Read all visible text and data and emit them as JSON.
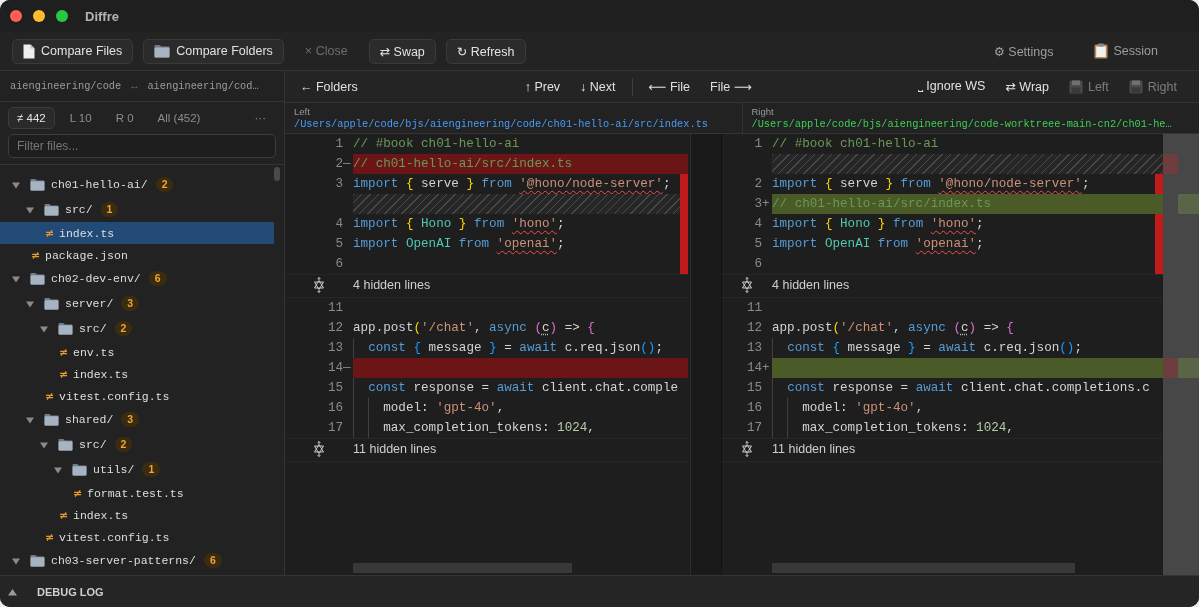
{
  "window": {
    "title": "Diffre"
  },
  "toolbar": {
    "start": [
      {
        "label": "Compare Files",
        "kind": "document",
        "disabled": false
      },
      {
        "label": "Compare Folders",
        "kind": "folder",
        "disabled": false
      },
      {
        "label": "× Close",
        "kind": "plain",
        "disabled": true
      },
      {
        "label": "⇄ Swap",
        "kind": "bordered",
        "disabled": false
      },
      {
        "label": "↻ Refresh",
        "kind": "bordered",
        "disabled": false
      }
    ],
    "end": [
      {
        "label": "⚙ Settings",
        "kind": "plain",
        "disabled": false
      },
      {
        "label": "Session",
        "kind": "clipboard",
        "disabled": false
      }
    ]
  },
  "sidebar": {
    "roots": {
      "left": "aiengineering/code",
      "separator": "↔",
      "right": "aiengineering/cod…"
    },
    "filters": [
      {
        "label": "≠ 442",
        "selected": true
      },
      {
        "label": "L 10",
        "selected": false
      },
      {
        "label": "R 0",
        "selected": false
      },
      {
        "label": "All (452)",
        "selected": false
      }
    ],
    "more": "···",
    "search": {
      "placeholder": "Filter files..."
    },
    "tree": [
      {
        "kind": "folder",
        "name": "ch01-hello-ai/",
        "count": "2",
        "expanded": true,
        "selected": false,
        "children": [
          {
            "kind": "folder",
            "name": "src/",
            "count": "1",
            "expanded": true,
            "selected": false,
            "children": [
              {
                "kind": "file",
                "marker": "≠",
                "name": "index.ts",
                "selected": true
              }
            ]
          },
          {
            "kind": "file",
            "marker": "≠",
            "name": "package.json",
            "selected": false
          }
        ]
      },
      {
        "kind": "folder",
        "name": "ch02-dev-env/",
        "count": "6",
        "expanded": true,
        "selected": false,
        "children": [
          {
            "kind": "folder",
            "name": "server/",
            "count": "3",
            "expanded": true,
            "selected": false,
            "children": [
              {
                "kind": "folder",
                "name": "src/",
                "count": "2",
                "expanded": true,
                "selected": false,
                "children": [
                  {
                    "kind": "file",
                    "marker": "≠",
                    "name": "env.ts",
                    "selected": false
                  },
                  {
                    "kind": "file",
                    "marker": "≠",
                    "name": "index.ts",
                    "selected": false
                  }
                ]
              },
              {
                "kind": "file",
                "marker": "≠",
                "name": "vitest.config.ts",
                "selected": false
              }
            ]
          },
          {
            "kind": "folder",
            "name": "shared/",
            "count": "3",
            "expanded": true,
            "selected": false,
            "children": [
              {
                "kind": "folder",
                "name": "src/",
                "count": "2",
                "expanded": true,
                "selected": false,
                "children": [
                  {
                    "kind": "folder",
                    "name": "utils/",
                    "count": "1",
                    "expanded": true,
                    "selected": false,
                    "children": [
                      {
                        "kind": "file",
                        "marker": "≠",
                        "name": "format.test.ts",
                        "selected": false
                      }
                    ]
                  },
                  {
                    "kind": "file",
                    "marker": "≠",
                    "name": "index.ts",
                    "selected": false
                  }
                ]
              },
              {
                "kind": "file",
                "marker": "≠",
                "name": "vitest.config.ts",
                "selected": false
              }
            ]
          }
        ]
      },
      {
        "kind": "folder",
        "name": "ch03-server-patterns/",
        "count": "6",
        "expanded": true,
        "selected": false
      }
    ]
  },
  "nav": {
    "start": [
      {
        "label": "← Folders",
        "kind": "text",
        "disabled": false
      }
    ],
    "groups": [
      [
        {
          "label": "↑ Prev",
          "kind": "text",
          "disabled": false
        },
        {
          "label": "↓ Next",
          "kind": "text",
          "disabled": false
        }
      ],
      [
        {
          "label": "⟵ File",
          "kind": "text",
          "disabled": false
        },
        {
          "label": "File ⟶",
          "kind": "text",
          "disabled": false
        }
      ]
    ],
    "end": [
      {
        "label": "⎵ Ignore WS",
        "kind": "text",
        "disabled": false
      },
      {
        "label": "⇄ Wrap",
        "kind": "text",
        "disabled": false
      },
      {
        "label": "Left",
        "kind": "disk",
        "disabled": true
      },
      {
        "label": "Right",
        "kind": "disk",
        "disabled": true
      }
    ]
  },
  "panes": [
    {
      "label": "Left",
      "path": "/Users/apple/code/bjs/aiengineering/code/ch01-hello-ai/src/index.ts",
      "color": "#4a9bf5",
      "rows": [
        {
          "kind": "context",
          "number": "1",
          "flagged": false,
          "tokens": [
            {
              "kind": "comment",
              "text": "// #book ch01-hello-ai"
            }
          ]
        },
        {
          "kind": "deleted",
          "number": "2",
          "sign": "—",
          "flagged": false,
          "tokens": [
            {
              "kind": "comment",
              "text": "// ch01-hello-ai/src/index.ts"
            }
          ]
        },
        {
          "kind": "context",
          "number": "3",
          "flagged": true,
          "tokens": [
            {
              "kind": "keyword",
              "text": "import "
            },
            {
              "kind": "bracket1",
              "text": "{ "
            },
            {
              "kind": "plain",
              "text": "serve "
            },
            {
              "kind": "bracket1",
              "text": "} "
            },
            {
              "kind": "keyword",
              "text": "from "
            },
            {
              "kind": "error",
              "text": "'@hono/node-server'"
            },
            {
              "kind": "plain",
              "text": ";"
            }
          ]
        },
        {
          "kind": "filler",
          "flagged": true
        },
        {
          "kind": "context",
          "number": "4",
          "flagged": true,
          "tokens": [
            {
              "kind": "keyword",
              "text": "import "
            },
            {
              "kind": "bracket1",
              "text": "{ "
            },
            {
              "kind": "type",
              "text": "Hono "
            },
            {
              "kind": "bracket1",
              "text": "} "
            },
            {
              "kind": "keyword",
              "text": "from "
            },
            {
              "kind": "error",
              "text": "'hono'"
            },
            {
              "kind": "plain",
              "text": ";"
            }
          ]
        },
        {
          "kind": "context",
          "number": "5",
          "flagged": true,
          "tokens": [
            {
              "kind": "keyword",
              "text": "import "
            },
            {
              "kind": "type",
              "text": "OpenAI "
            },
            {
              "kind": "keyword",
              "text": "from "
            },
            {
              "kind": "error",
              "text": "'openai'"
            },
            {
              "kind": "plain",
              "text": ";"
            }
          ]
        },
        {
          "kind": "context",
          "number": "6",
          "flagged": true
        },
        {
          "kind": "hidden",
          "text": "4 hidden lines",
          "flagged": false
        },
        {
          "kind": "context",
          "number": "11",
          "flagged": false
        },
        {
          "kind": "context",
          "number": "12",
          "flagged": false,
          "tokens": [
            {
              "kind": "plain",
              "text": "app.post"
            },
            {
              "kind": "bracket1",
              "text": "("
            },
            {
              "kind": "string",
              "text": "'/chat'"
            },
            {
              "kind": "plain",
              "text": ", "
            },
            {
              "kind": "keyword",
              "text": "async "
            },
            {
              "kind": "bracket2",
              "text": "("
            },
            {
              "kind": "hint",
              "text": "c"
            },
            {
              "kind": "bracket2",
              "text": ") "
            },
            {
              "kind": "plain",
              "text": "=> "
            },
            {
              "kind": "bracket2",
              "text": "{"
            }
          ]
        },
        {
          "kind": "context",
          "number": "13",
          "flagged": false,
          "tokens": [
            {
              "kind": "keyword",
              "text": "  const "
            },
            {
              "kind": "bracket3",
              "text": "{ "
            },
            {
              "kind": "plain",
              "text": "message "
            },
            {
              "kind": "bracket3",
              "text": "} "
            },
            {
              "kind": "plain",
              "text": "= "
            },
            {
              "kind": "keyword",
              "text": "await "
            },
            {
              "kind": "plain",
              "text": "c.req.json"
            },
            {
              "kind": "bracket3",
              "text": "()"
            },
            {
              "kind": "plain",
              "text": ";"
            }
          ]
        },
        {
          "kind": "deleted",
          "number": "14",
          "sign": "—",
          "flagged": false
        },
        {
          "kind": "context",
          "number": "15",
          "flagged": false,
          "tokens": [
            {
              "kind": "keyword",
              "text": "  const "
            },
            {
              "kind": "plain",
              "text": "response = "
            },
            {
              "kind": "keyword",
              "text": "await "
            },
            {
              "kind": "plain",
              "text": "client.chat.comple"
            }
          ]
        },
        {
          "kind": "context",
          "number": "16",
          "flagged": false,
          "tokens": [
            {
              "kind": "plain",
              "text": "    model: "
            },
            {
              "kind": "string",
              "text": "'gpt-4o'"
            },
            {
              "kind": "plain",
              "text": ","
            }
          ]
        },
        {
          "kind": "context",
          "number": "17",
          "flagged": false,
          "tokens": [
            {
              "kind": "plain",
              "text": "    max_completion_tokens: "
            },
            {
              "kind": "number",
              "text": "1024"
            },
            {
              "kind": "plain",
              "text": ","
            }
          ]
        },
        {
          "kind": "hidden",
          "text": "11 hidden lines",
          "flagged": false
        }
      ]
    },
    {
      "label": "Right",
      "path": "/Users/apple/code/bjs/aiengineering/code-worktreee-main-cn2/ch01-he…",
      "color": "#3fcf55",
      "rows": [
        {
          "kind": "context",
          "number": "1",
          "flagged": false,
          "tokens": [
            {
              "kind": "comment",
              "text": "// #book ch01-hello-ai"
            }
          ]
        },
        {
          "kind": "filler",
          "flagged": false
        },
        {
          "kind": "context",
          "number": "2",
          "flagged": true,
          "tokens": [
            {
              "kind": "keyword",
              "text": "import "
            },
            {
              "kind": "bracket1",
              "text": "{ "
            },
            {
              "kind": "plain",
              "text": "serve "
            },
            {
              "kind": "bracket1",
              "text": "} "
            },
            {
              "kind": "keyword",
              "text": "from "
            },
            {
              "kind": "error",
              "text": "'@hono/node-server'"
            },
            {
              "kind": "plain",
              "text": ";"
            }
          ]
        },
        {
          "kind": "added",
          "number": "3",
          "sign": "+",
          "flagged": false,
          "tokens": [
            {
              "kind": "comment",
              "text": "// ch01-hello-ai/src/index.ts"
            }
          ]
        },
        {
          "kind": "context",
          "number": "4",
          "flagged": true,
          "tokens": [
            {
              "kind": "keyword",
              "text": "import "
            },
            {
              "kind": "bracket1",
              "text": "{ "
            },
            {
              "kind": "type",
              "text": "Hono "
            },
            {
              "kind": "bracket1",
              "text": "} "
            },
            {
              "kind": "keyword",
              "text": "from "
            },
            {
              "kind": "error",
              "text": "'hono'"
            },
            {
              "kind": "plain",
              "text": ";"
            }
          ]
        },
        {
          "kind": "context",
          "number": "5",
          "flagged": true,
          "tokens": [
            {
              "kind": "keyword",
              "text": "import "
            },
            {
              "kind": "type",
              "text": "OpenAI "
            },
            {
              "kind": "keyword",
              "text": "from "
            },
            {
              "kind": "error",
              "text": "'openai'"
            },
            {
              "kind": "plain",
              "text": ";"
            }
          ]
        },
        {
          "kind": "context",
          "number": "6",
          "flagged": true
        },
        {
          "kind": "hidden",
          "text": "4 hidden lines",
          "flagged": false
        },
        {
          "kind": "context",
          "number": "11",
          "flagged": false
        },
        {
          "kind": "context",
          "number": "12",
          "flagged": false,
          "tokens": [
            {
              "kind": "plain",
              "text": "app.post"
            },
            {
              "kind": "bracket1",
              "text": "("
            },
            {
              "kind": "string",
              "text": "'/chat'"
            },
            {
              "kind": "plain",
              "text": ", "
            },
            {
              "kind": "keyword",
              "text": "async "
            },
            {
              "kind": "bracket2",
              "text": "("
            },
            {
              "kind": "hint",
              "text": "c"
            },
            {
              "kind": "bracket2",
              "text": ") "
            },
            {
              "kind": "plain",
              "text": "=> "
            },
            {
              "kind": "bracket2",
              "text": "{"
            }
          ]
        },
        {
          "kind": "context",
          "number": "13",
          "flagged": false,
          "tokens": [
            {
              "kind": "keyword",
              "text": "  const "
            },
            {
              "kind": "bracket3",
              "text": "{ "
            },
            {
              "kind": "plain",
              "text": "message "
            },
            {
              "kind": "bracket3",
              "text": "} "
            },
            {
              "kind": "plain",
              "text": "= "
            },
            {
              "kind": "keyword",
              "text": "await "
            },
            {
              "kind": "plain",
              "text": "c.req.json"
            },
            {
              "kind": "bracket3",
              "text": "()"
            },
            {
              "kind": "plain",
              "text": ";"
            }
          ]
        },
        {
          "kind": "added",
          "number": "14",
          "sign": "+",
          "flagged": false
        },
        {
          "kind": "context",
          "number": "15",
          "flagged": false,
          "tokens": [
            {
              "kind": "keyword",
              "text": "  const "
            },
            {
              "kind": "plain",
              "text": "response = "
            },
            {
              "kind": "keyword",
              "text": "await "
            },
            {
              "kind": "plain",
              "text": "client.chat.completions.c"
            }
          ]
        },
        {
          "kind": "context",
          "number": "16",
          "flagged": false,
          "tokens": [
            {
              "kind": "plain",
              "text": "    model: "
            },
            {
              "kind": "string",
              "text": "'gpt-4o'"
            },
            {
              "kind": "plain",
              "text": ","
            }
          ]
        },
        {
          "kind": "context",
          "number": "17",
          "flagged": false,
          "tokens": [
            {
              "kind": "plain",
              "text": "    max_completion_tokens: "
            },
            {
              "kind": "number",
              "text": "1024"
            },
            {
              "kind": "plain",
              "text": ","
            }
          ]
        },
        {
          "kind": "hidden",
          "text": "11 hidden lines",
          "flagged": false
        }
      ]
    }
  ],
  "debug_log": {
    "label": "DEBUG LOG",
    "expanded": false
  }
}
